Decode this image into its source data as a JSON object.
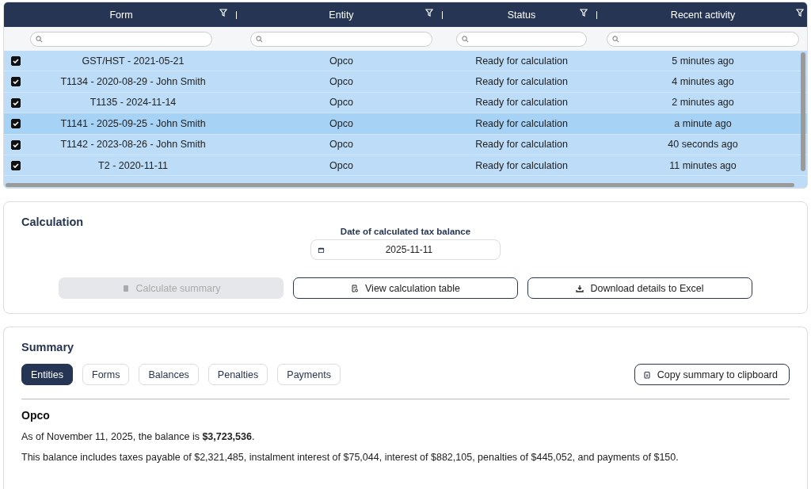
{
  "table": {
    "columns": [
      {
        "label": "Form"
      },
      {
        "label": "Entity"
      },
      {
        "label": "Status"
      },
      {
        "label": "Recent activity"
      }
    ],
    "rows": [
      {
        "checked": true,
        "selected": false,
        "form": "GST/HST - 2021-05-21",
        "entity": "Opco",
        "status": "Ready for calculation",
        "activity": "5 minutes ago"
      },
      {
        "checked": true,
        "selected": false,
        "form": "T1134 - 2020-08-29 - John Smith",
        "entity": "Opco",
        "status": "Ready for calculation",
        "activity": "4 minutes ago"
      },
      {
        "checked": true,
        "selected": false,
        "form": "T1135 - 2024-11-14",
        "entity": "Opco",
        "status": "Ready for calculation",
        "activity": "2 minutes ago"
      },
      {
        "checked": true,
        "selected": true,
        "form": "T1141 - 2025-09-25 - John Smith",
        "entity": "Opco",
        "status": "Ready for calculation",
        "activity": "a minute ago"
      },
      {
        "checked": true,
        "selected": false,
        "form": "T1142 - 2023-08-26 - John Smith",
        "entity": "Opco",
        "status": "Ready for calculation",
        "activity": "40 seconds ago"
      },
      {
        "checked": true,
        "selected": false,
        "form": "T2 - 2020-11-11",
        "entity": "Opco",
        "status": "Ready for calculation",
        "activity": "11 minutes ago"
      }
    ]
  },
  "calculation": {
    "title": "Calculation",
    "date_label": "Date of calculated tax balance",
    "date": "2025-11-11",
    "buttons": [
      {
        "label": "Calculate summary",
        "kind": "calc",
        "disabled": true
      },
      {
        "label": "View calculation table",
        "kind": "table",
        "disabled": false
      },
      {
        "label": "Download details to Excel",
        "kind": "download",
        "disabled": false
      }
    ]
  },
  "summary": {
    "title": "Summary",
    "tabs": [
      {
        "label": "Entities",
        "selected": true
      },
      {
        "label": "Forms",
        "selected": false
      },
      {
        "label": "Balances",
        "selected": false
      },
      {
        "label": "Penalties",
        "selected": false
      },
      {
        "label": "Payments",
        "selected": false
      }
    ],
    "copy_button": "Copy summary to clipboard",
    "entity": "Opco",
    "paragraphs": [
      "As of November 11, 2025, the balance is **$3,723,536**.",
      "This balance includes taxes payable of $2,321,485, instalment interest of $75,044, interest of $882,105, penalties of $445,052, and payments of $150."
    ]
  }
}
